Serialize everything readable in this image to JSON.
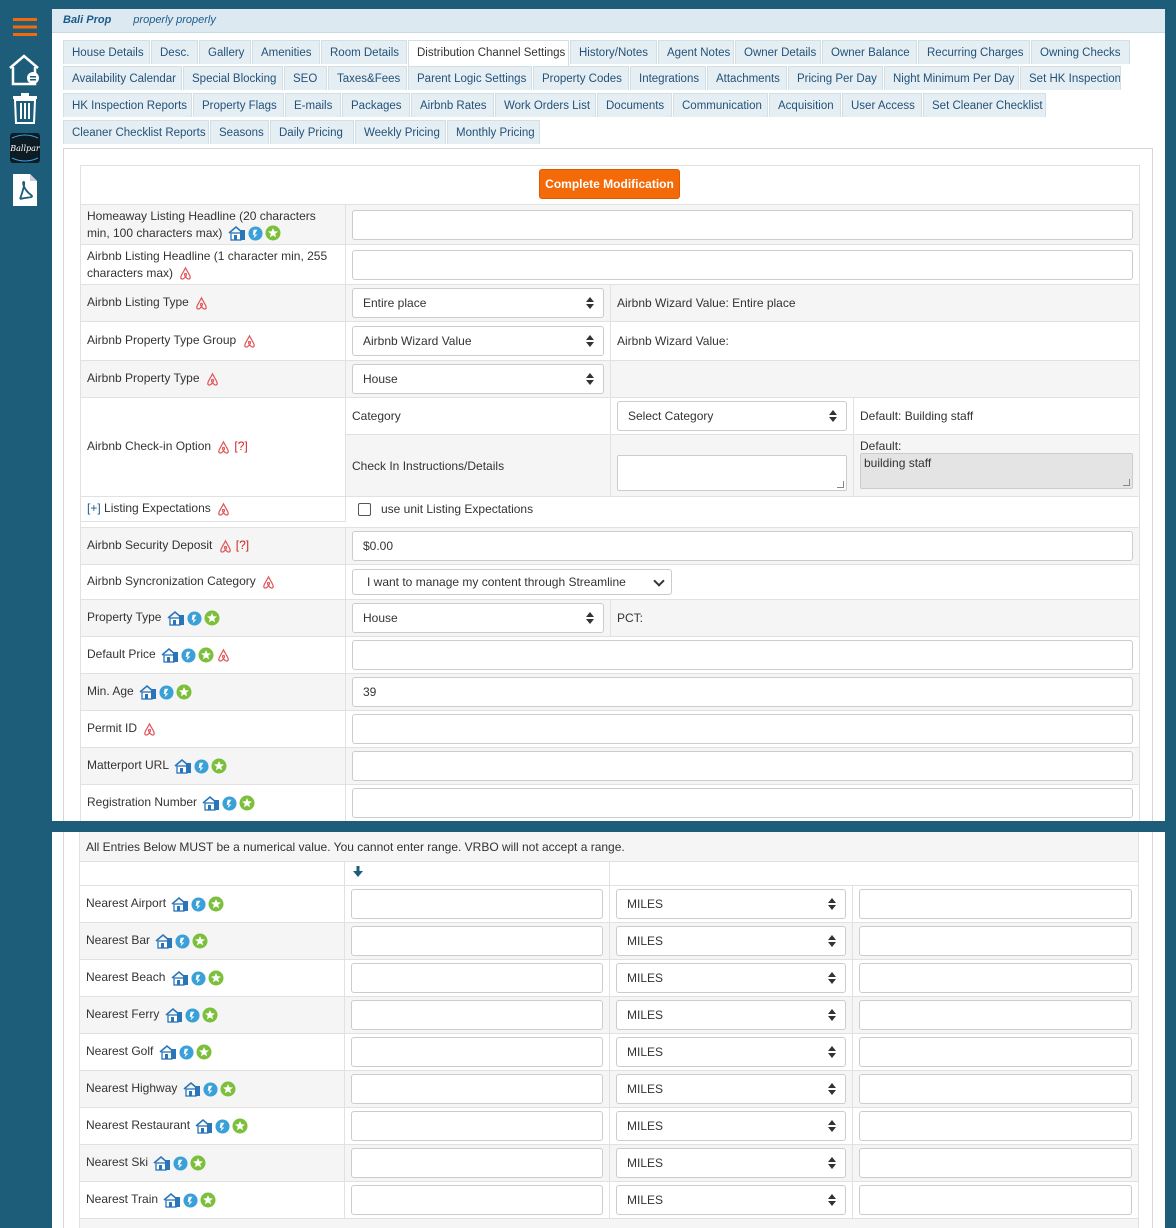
{
  "property": {
    "name": "Bali Prop",
    "subtitle": "properly properly"
  },
  "tabs": [
    {
      "label": "House Details"
    },
    {
      "label": "Desc."
    },
    {
      "label": "Gallery"
    },
    {
      "label": "Amenities"
    },
    {
      "label": "Room Details"
    },
    {
      "label": "Distribution Channel Settings",
      "active": true
    },
    {
      "label": "History/Notes"
    },
    {
      "label": "Agent Notes"
    },
    {
      "label": "Owner Details"
    },
    {
      "label": "Owner Balance"
    },
    {
      "label": "Recurring Charges"
    },
    {
      "label": "Owning Checks"
    },
    {
      "label": "Availability Calendar"
    },
    {
      "label": "Special Blocking"
    },
    {
      "label": "SEO"
    },
    {
      "label": "Taxes&Fees"
    },
    {
      "label": "Parent Logic Settings"
    },
    {
      "label": "Property Codes"
    },
    {
      "label": "Integrations"
    },
    {
      "label": "Attachments"
    },
    {
      "label": "Pricing Per Day"
    },
    {
      "label": "Night Minimum Per Day"
    },
    {
      "label": "Set HK Inspection"
    },
    {
      "label": "HK Inspection Reports"
    },
    {
      "label": "Property Flags"
    },
    {
      "label": "E-mails"
    },
    {
      "label": "Packages"
    },
    {
      "label": "Airbnb Rates"
    },
    {
      "label": "Work Orders List"
    },
    {
      "label": "Documents"
    },
    {
      "label": "Communication"
    },
    {
      "label": "Acquisition"
    },
    {
      "label": "User Access"
    },
    {
      "label": "Set Cleaner Checklist"
    },
    {
      "label": "Cleaner Checklist Reports"
    },
    {
      "label": "Seasons"
    },
    {
      "label": "Daily Pricing"
    },
    {
      "label": "Weekly Pricing"
    },
    {
      "label": "Monthly Pricing"
    }
  ],
  "complete_button": "Complete Modification",
  "form": {
    "homeaway_headline": {
      "label": "Homeaway Listing Headline (20 characters min, 100 characters max)",
      "value": ""
    },
    "airbnb_headline": {
      "label": "Airbnb Listing Headline (1 character min, 255 characters max)",
      "value": ""
    },
    "listing_type": {
      "label": "Airbnb Listing Type",
      "value": "Entire place",
      "wizard": "Airbnb Wizard Value: Entire place"
    },
    "property_type_group": {
      "label": "Airbnb Property Type Group",
      "value": "Airbnb Wizard Value",
      "wizard": "Airbnb Wizard Value:"
    },
    "airbnb_property_type": {
      "label": "Airbnb Property Type",
      "value": "House"
    },
    "checkin": {
      "label": "Airbnb Check-in Option",
      "help": "[?]",
      "category_label": "Category",
      "category_value": "Select Category",
      "default_category": "Default: Building staff",
      "instructions_label": "Check In Instructions/Details",
      "default_label": "Default:",
      "default_instructions": "building staff"
    },
    "listing_expectations": {
      "toggle": "[+]",
      "label": "Listing Expectations",
      "checkbox_label": "use unit Listing Expectations"
    },
    "security_deposit": {
      "label": "Airbnb Security Deposit",
      "help": "[?]",
      "value": "$0.00"
    },
    "sync_category": {
      "label": "Airbnb Syncronization Category",
      "value": "I want to manage my content through Streamline"
    },
    "property_type": {
      "label": "Property Type",
      "value": "House",
      "pct": "PCT:"
    },
    "default_price": {
      "label": "Default Price",
      "value": ""
    },
    "min_age": {
      "label": "Min. Age",
      "value": "39"
    },
    "permit_id": {
      "label": "Permit ID",
      "value": ""
    },
    "matterport_url": {
      "label": "Matterport URL",
      "value": ""
    },
    "registration_number": {
      "label": "Registration Number",
      "value": ""
    }
  },
  "nearest": {
    "note": "All Entries Below MUST be a numerical value. You cannot enter range. VRBO will not accept a range.",
    "unit": "MILES",
    "rows": [
      {
        "label": "Nearest Airport"
      },
      {
        "label": "Nearest Bar"
      },
      {
        "label": "Nearest Beach"
      },
      {
        "label": "Nearest Ferry"
      },
      {
        "label": "Nearest Golf"
      },
      {
        "label": "Nearest Highway"
      },
      {
        "label": "Nearest Restaurant"
      },
      {
        "label": "Nearest Ski"
      },
      {
        "label": "Nearest Train"
      }
    ]
  },
  "colors": {
    "sidebar": "#1e5d7a",
    "accent": "#f56a08",
    "airbnb": "#e0565b",
    "homeaway": "#2a74b8",
    "star": "#7cbf3a"
  }
}
